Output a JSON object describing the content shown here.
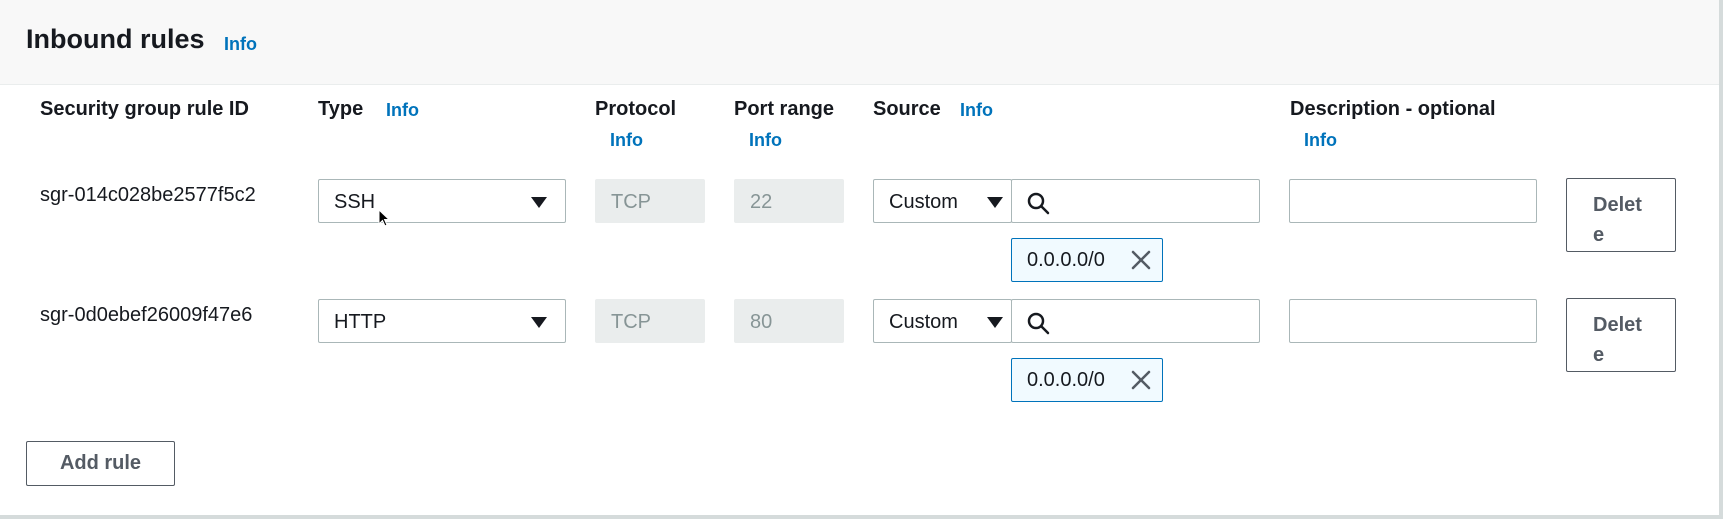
{
  "section": {
    "title": "Inbound rules",
    "info_label": "Info"
  },
  "columns": {
    "rule_id": "Security group rule ID",
    "type": "Type",
    "protocol": "Protocol",
    "port_range": "Port range",
    "source": "Source",
    "description": "Description - optional",
    "info_label": "Info"
  },
  "rules": [
    {
      "rule_id": "sgr-014c028be2577f5c2",
      "type": "SSH",
      "protocol": "TCP",
      "port_range": "22",
      "source_type": "Custom",
      "source_search": "",
      "source_token": "0.0.0.0/0",
      "description": "",
      "delete_label": "Delete"
    },
    {
      "rule_id": "sgr-0d0ebef26009f47e6",
      "type": "HTTP",
      "protocol": "TCP",
      "port_range": "80",
      "source_type": "Custom",
      "source_search": "",
      "source_token": "0.0.0.0/0",
      "description": "",
      "delete_label": "Delete"
    }
  ],
  "actions": {
    "add_rule_label": "Add rule"
  },
  "colors": {
    "link": "#0073bb",
    "token_bg": "#f1faff",
    "disabled_bg": "#eaeded",
    "header_bg": "#f8f8f8"
  }
}
